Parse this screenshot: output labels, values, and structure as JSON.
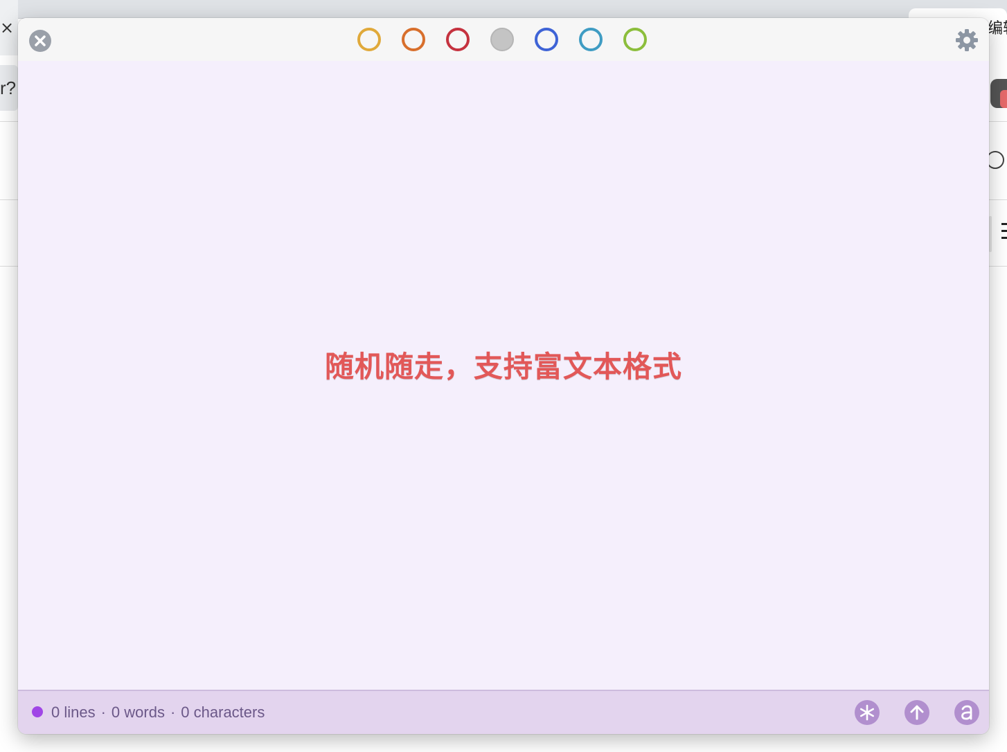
{
  "background": {
    "left_close_glyph": "×",
    "left_address_fragment": "r?",
    "right_tab_fragment": "编辑"
  },
  "window": {
    "color_rings": [
      {
        "name": "ring-yellow",
        "color": "#e0a93a",
        "filled": false
      },
      {
        "name": "ring-orange",
        "color": "#d86f2c",
        "filled": false
      },
      {
        "name": "ring-red",
        "color": "#c5323f",
        "filled": false
      },
      {
        "name": "ring-gray",
        "color": "#c4c4c4",
        "filled": true
      },
      {
        "name": "ring-blue",
        "color": "#3e63d6",
        "filled": false
      },
      {
        "name": "ring-teal",
        "color": "#3f9cc3",
        "filled": false
      },
      {
        "name": "ring-green",
        "color": "#8cbe3c",
        "filled": false
      }
    ],
    "icons": {
      "close": "close-circle-icon",
      "settings": "gear-icon",
      "markdown": "asterisk-icon",
      "share": "arrow-up-icon",
      "font": "letter-a-icon"
    },
    "editor_text": "随机随走，支持富文本格式",
    "editor_text_color": "#e25858",
    "status": {
      "dot_color": "#a046e6",
      "lines": "0 lines",
      "words": "0 words",
      "characters": "0 characters",
      "separator": "·"
    }
  }
}
